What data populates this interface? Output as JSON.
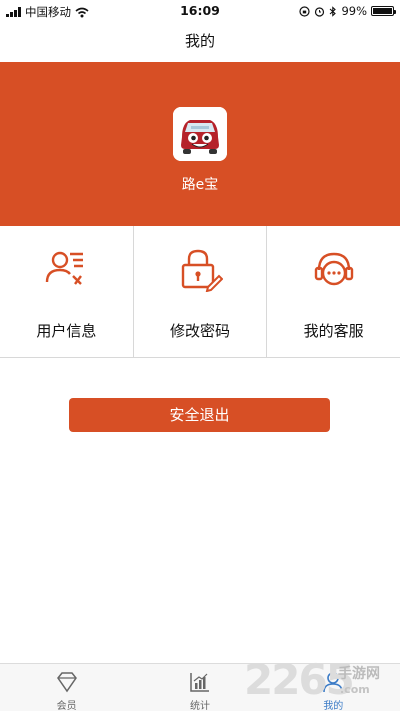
{
  "status_bar": {
    "carrier": "中国移动",
    "time": "16:09",
    "battery": "99%",
    "battery_level": 0.99
  },
  "nav": {
    "title": "我的"
  },
  "profile": {
    "app_name": "路e宝",
    "avatar_icon": "red-car-cartoon-icon"
  },
  "menu": {
    "items": [
      {
        "label": "用户信息",
        "icon": "user-info-icon"
      },
      {
        "label": "修改密码",
        "icon": "lock-edit-icon"
      },
      {
        "label": "我的客服",
        "icon": "customer-service-icon"
      }
    ]
  },
  "logout": {
    "label": "安全退出"
  },
  "tabs": [
    {
      "label": "会员",
      "icon": "diamond-icon"
    },
    {
      "label": "统计",
      "icon": "bar-chart-icon"
    },
    {
      "label": "我的",
      "icon": "person-icon",
      "active": true
    }
  ],
  "watermark": {
    "number": "2265",
    "name": "手游网",
    "url": ".com"
  },
  "colors": {
    "accent": "#d74f25",
    "tab_active": "#3c7cc7"
  }
}
